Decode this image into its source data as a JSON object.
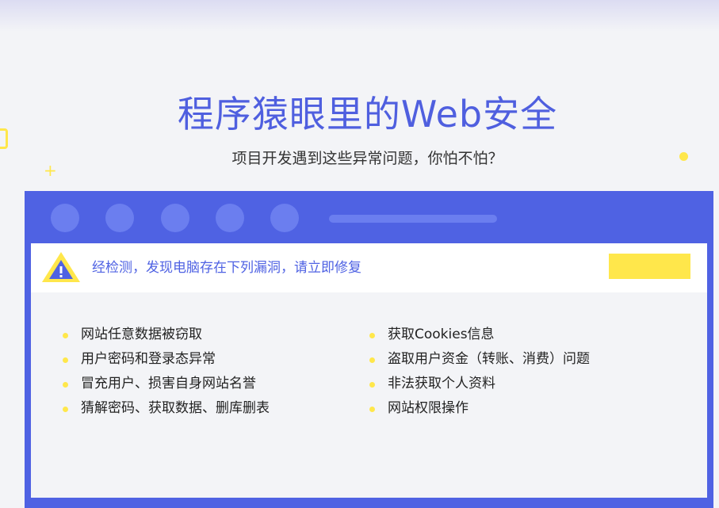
{
  "hero": {
    "title": "程序猿眼里的Web安全",
    "subtitle": "项目开发遇到这些异常问题，你怕不怕？"
  },
  "alert": {
    "icon": "warning-triangle-icon",
    "message": "经检测，发现电脑存在下列漏洞，请立即修复",
    "button_label": ""
  },
  "issues": {
    "left": [
      "网站任意数据被窃取",
      "用户密码和登录态异常",
      "冒充用户、损害自身网站名誉",
      "猜解密码、获取数据、删库删表"
    ],
    "right": [
      "获取Cookies信息",
      "盗取用户资金（转账、消费）问题",
      "非法获取个人资料",
      "网站权限操作"
    ]
  },
  "colors": {
    "accent": "#4f62e3",
    "title": "#4f5fdf",
    "highlight": "#ffe74b",
    "browser_dot": "#6b7eef",
    "background": "#f3f4f7"
  }
}
